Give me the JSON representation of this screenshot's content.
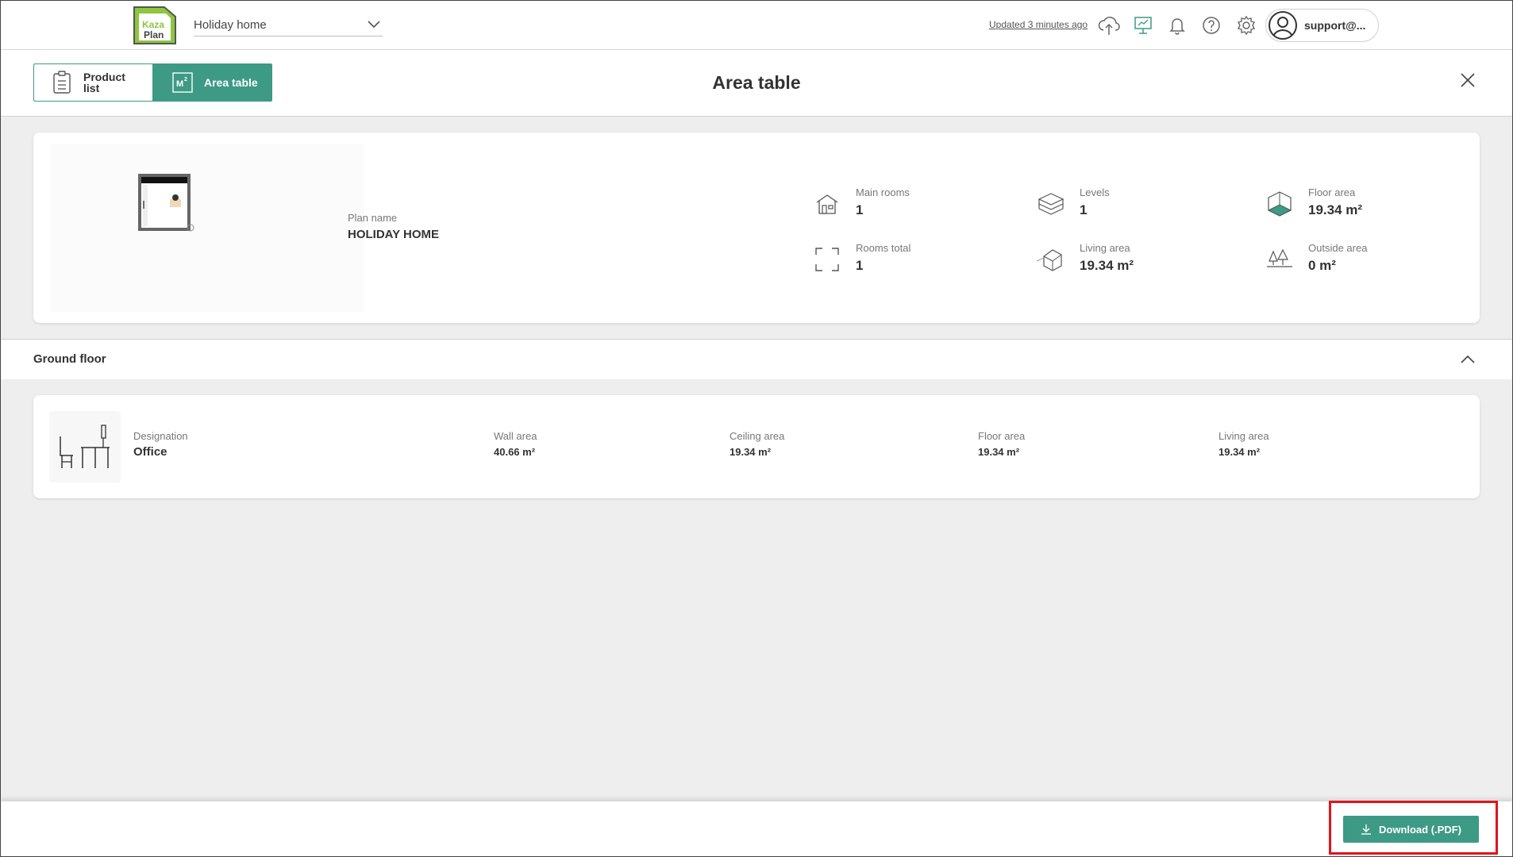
{
  "topbar": {
    "logo_text_line1": "Kaza",
    "logo_text_line2": "Plan",
    "plan_name": "Holiday home",
    "updated_text": "Updated 3 minutes ago",
    "user_name": "support@...",
    "icons": [
      "cloud-upload-icon",
      "monitor-icon",
      "bell-icon",
      "help-icon",
      "gear-icon",
      "user-avatar-icon"
    ]
  },
  "header": {
    "tabs": [
      {
        "label": "Product list",
        "icon": "clipboard-icon",
        "active": false
      },
      {
        "label": "Area table",
        "icon": "m2-icon",
        "active": true
      }
    ],
    "m2_icon_text": "M",
    "m2_icon_sup": "2",
    "title": "Area table"
  },
  "summary": {
    "plan_name_label": "Plan name",
    "plan_name_value": "HOLIDAY HOME",
    "stats": [
      {
        "label": "Main rooms",
        "value": "1",
        "icon": "house-icon"
      },
      {
        "label": "Levels",
        "value": "1",
        "icon": "levels-icon"
      },
      {
        "label": "Floor area",
        "value": "19.34 m²",
        "icon": "floor-area-icon"
      },
      {
        "label": "Rooms total",
        "value": "1",
        "icon": "rooms-frame-icon"
      },
      {
        "label": "Living area",
        "value": "19.34 m²",
        "icon": "living-area-icon"
      },
      {
        "label": "Outside area",
        "value": "0 m²",
        "icon": "outside-area-icon"
      }
    ]
  },
  "ground_floor": {
    "title": "Ground floor",
    "room": {
      "designation_label": "Designation",
      "designation_value": "Office",
      "wall_area_label": "Wall area",
      "wall_area_value": "40.66 m²",
      "ceiling_area_label": "Ceiling area",
      "ceiling_area_value": "19.34 m²",
      "floor_area_label": "Floor area",
      "floor_area_value": "19.34 m²",
      "living_area_label": "Living area",
      "living_area_value": "19.34 m²"
    }
  },
  "footer": {
    "download_label": "Download (.PDF)"
  },
  "colors": {
    "accent": "#3d9a85",
    "logo_green": "#8dc63f",
    "highlight": "#e0141a",
    "background": "#eeeeee"
  }
}
